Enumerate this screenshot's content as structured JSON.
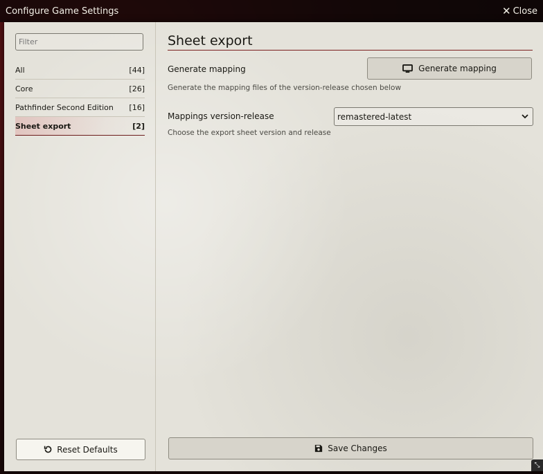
{
  "window": {
    "title": "Configure Game Settings",
    "close_label": "Close"
  },
  "sidebar": {
    "filter_placeholder": "Filter",
    "categories": [
      {
        "label": "All",
        "count": "[44]"
      },
      {
        "label": "Core",
        "count": "[26]"
      },
      {
        "label": "Pathfinder Second Edition",
        "count": "[16]"
      },
      {
        "label": "Sheet export",
        "count": "[2]"
      }
    ],
    "reset_label": "Reset Defaults"
  },
  "main": {
    "section_title": "Sheet export",
    "settings": [
      {
        "label": "Generate mapping",
        "button_label": "Generate mapping",
        "hint": "Generate the mapping files of the version-release chosen below"
      },
      {
        "label": "Mappings version-release",
        "selected": "remastered-latest",
        "hint": "Choose the export sheet version and release"
      }
    ],
    "save_label": "Save Changes"
  },
  "icons": {
    "close": "close-icon",
    "reset": "undo-icon",
    "generate": "desktop-icon",
    "save": "floppy-disk-icon",
    "dropdown": "chevron-down-icon",
    "resize": "resize-icon"
  },
  "colors": {
    "active_accent": "#6b1a1a",
    "panel_bg": "#e4e2da",
    "titlebar_bg": "#0c0606"
  }
}
